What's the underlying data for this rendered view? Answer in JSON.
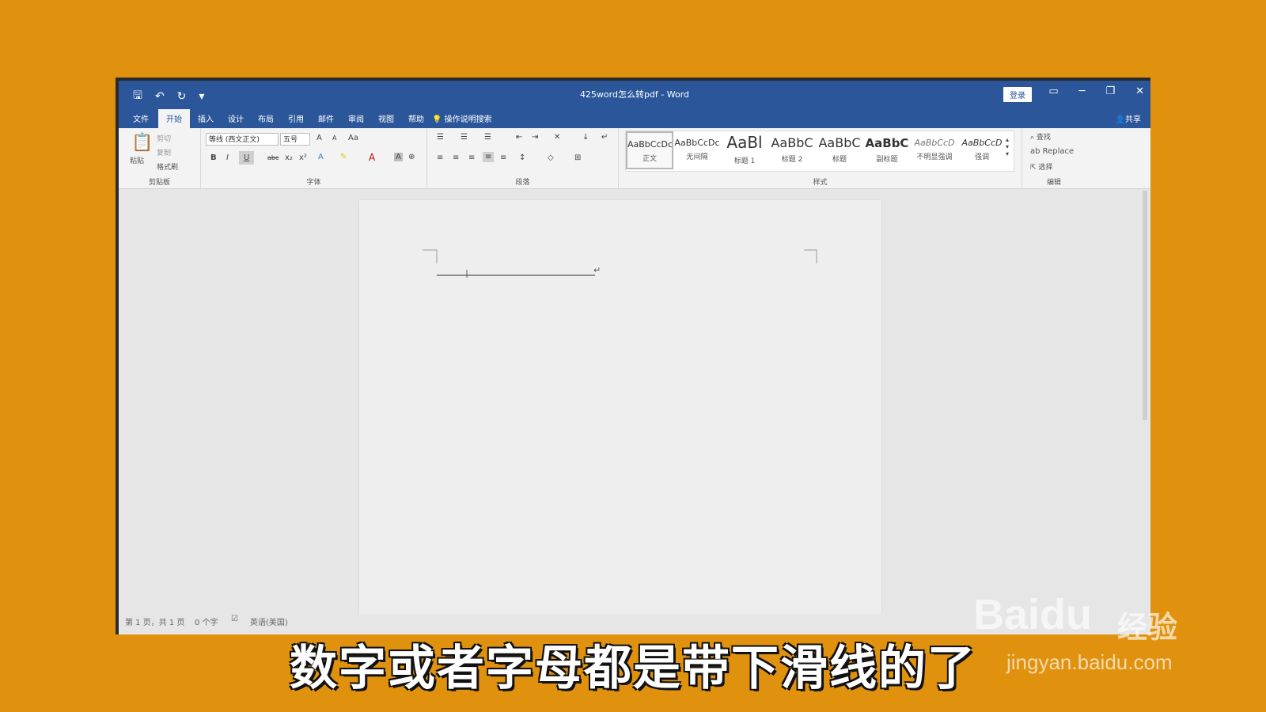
{
  "window": {
    "title": "425word怎么转pdf - Word",
    "login": "登录",
    "qat": [
      "🖫",
      "↶",
      "↻",
      "▾"
    ],
    "controls": [
      "▭",
      "─",
      "❐",
      "✕"
    ]
  },
  "menu": {
    "tabs": [
      "文件",
      "开始",
      "插入",
      "设计",
      "布局",
      "引用",
      "邮件",
      "审阅",
      "视图",
      "帮助"
    ],
    "active": "开始",
    "search": "操作说明搜索",
    "share": "共享"
  },
  "ribbon": {
    "clipboard": {
      "paste": "粘贴",
      "cut": "剪切",
      "copy": "复制",
      "format_painter": "格式刷",
      "label": "剪贴板"
    },
    "font": {
      "family": "等线 (西文正文)",
      "size": "五号",
      "label": "字体",
      "buttons": [
        "B",
        "I",
        "U",
        "abc",
        "x₂",
        "x²"
      ],
      "grow": "A",
      "shrink": "A",
      "case": "Aa"
    },
    "paragraph": {
      "label": "段落"
    },
    "styles": {
      "label": "样式",
      "items": [
        {
          "preview": "AaBbCcDc",
          "name": "正文"
        },
        {
          "preview": "AaBbCcDc",
          "name": "无间隔"
        },
        {
          "preview": "AaBl",
          "name": "标题 1"
        },
        {
          "preview": "AaBbC",
          "name": "标题 2"
        },
        {
          "preview": "AaBbC",
          "name": "标题"
        },
        {
          "preview": "AaBbC",
          "name": "副标题"
        },
        {
          "preview": "AaBbCcD",
          "name": "不明显强调"
        },
        {
          "preview": "AaBbCcD",
          "name": "强调"
        }
      ]
    },
    "editing": {
      "find": "查找",
      "replace": "Replace",
      "select": "选择",
      "label": "编辑"
    }
  },
  "status": {
    "page": "第 1 页，共 1 页",
    "words": "0 个字",
    "language": "英语(美国)"
  },
  "caption": "数字或者字母都是带下滑线的了",
  "watermark": {
    "logo": "Baidu",
    "cn": "经验",
    "url": "jingyan.baidu.com"
  },
  "colors": {
    "accent": "#2b579a",
    "background": "#e0920f"
  }
}
